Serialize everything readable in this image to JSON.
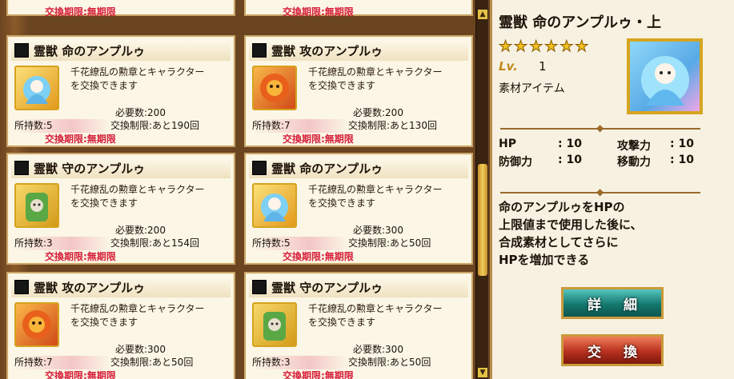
{
  "list": {
    "top_period_left": "交換期限:無期限",
    "top_period_right": "交換期限:無期限",
    "cards": [
      {
        "title": "霊獣 命のアンプルゥ",
        "desc1": "千花繚乱の勲章とキャラクター",
        "desc2": "を交換できます",
        "need": "必要数:200",
        "owned": "所持数:5",
        "limit": "交換制限:あと190回",
        "period": "交換期限:無期限",
        "icon": "ampule-hp-icon"
      },
      {
        "title": "霊獣 攻のアンプルゥ",
        "desc1": "千花繚乱の勲章とキャラクター",
        "desc2": "を交換できます",
        "need": "必要数:200",
        "owned": "所持数:7",
        "limit": "交換制限:あと130回",
        "period": "交換期限:無期限",
        "icon": "ampule-attack-icon"
      },
      {
        "title": "霊獣 守のアンプルゥ",
        "desc1": "千花繚乱の勲章とキャラクター",
        "desc2": "を交換できます",
        "need": "必要数:200",
        "owned": "所持数:3",
        "limit": "交換制限:あと154回",
        "period": "交換期限:無期限",
        "icon": "ampule-defense-icon"
      },
      {
        "title": "霊獣 命のアンプルゥ",
        "desc1": "千花繚乱の勲章とキャラクター",
        "desc2": "を交換できます",
        "need": "必要数:300",
        "owned": "所持数:5",
        "limit": "交換制限:あと50回",
        "period": "交換期限:無期限",
        "icon": "ampule-hp-icon"
      },
      {
        "title": "霊獣 攻のアンプルゥ",
        "desc1": "千花繚乱の勲章とキャラクター",
        "desc2": "を交換できます",
        "need": "必要数:300",
        "owned": "所持数:7",
        "limit": "交換制限:あと50回",
        "period": "交換期限:無期限",
        "icon": "ampule-attack-icon"
      },
      {
        "title": "霊獣 守のアンプルゥ",
        "desc1": "千花繚乱の勲章とキャラクター",
        "desc2": "を交換できます",
        "need": "必要数:300",
        "owned": "所持数:3",
        "limit": "交換制限:あと50回",
        "period": "交換期限:無期限",
        "icon": "ampule-defense-icon"
      }
    ]
  },
  "detail": {
    "title": "霊獣 命のアンプルゥ・上",
    "stars": [
      "★",
      "★",
      "★",
      "★",
      "★",
      "★"
    ],
    "lv_label": "Lv.",
    "lv_value": "1",
    "category": "素材アイテム",
    "stats": {
      "hp_label": "HP",
      "hp_value": ": 10",
      "atk_label": "攻撃力",
      "atk_value": ": 10",
      "def_label": "防御力",
      "def_value": ": 10",
      "mov_label": "移動力",
      "mov_value": ": 10"
    },
    "description": [
      "命のアンプルゥをHPの",
      "上限値まで使用した後に、",
      "合成素材としてさらに",
      "HPを増加できる"
    ],
    "detail_button": "詳細",
    "exchange_button": "交換"
  },
  "colors": {
    "period_red": "#d61f3a",
    "frame_gold": "#c99a3a",
    "detail_btn": "#13786e",
    "exchange_btn": "#b8311f"
  }
}
